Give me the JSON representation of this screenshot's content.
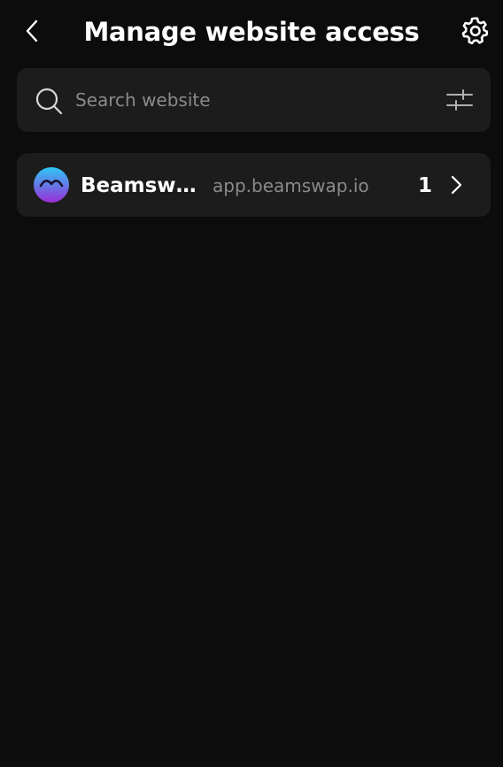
{
  "header": {
    "title": "Manage website access",
    "back_icon": "chevron-left-icon",
    "settings_icon": "gear-icon"
  },
  "search": {
    "placeholder": "Search website",
    "value": "",
    "search_icon": "search-icon",
    "filter_icon": "sliders-icon"
  },
  "websites": [
    {
      "name": "Beamswa…",
      "url": "app.beamswap.io",
      "count": "1",
      "logo_icon": "beamswap-logo"
    }
  ],
  "colors": {
    "background": "#0c0c0c",
    "card": "#1c1c1c",
    "text_primary": "#ffffff",
    "text_secondary": "#8a8a8a",
    "logo_gradient_top": "#2ec6f5",
    "logo_gradient_bottom": "#9b2fd8"
  }
}
